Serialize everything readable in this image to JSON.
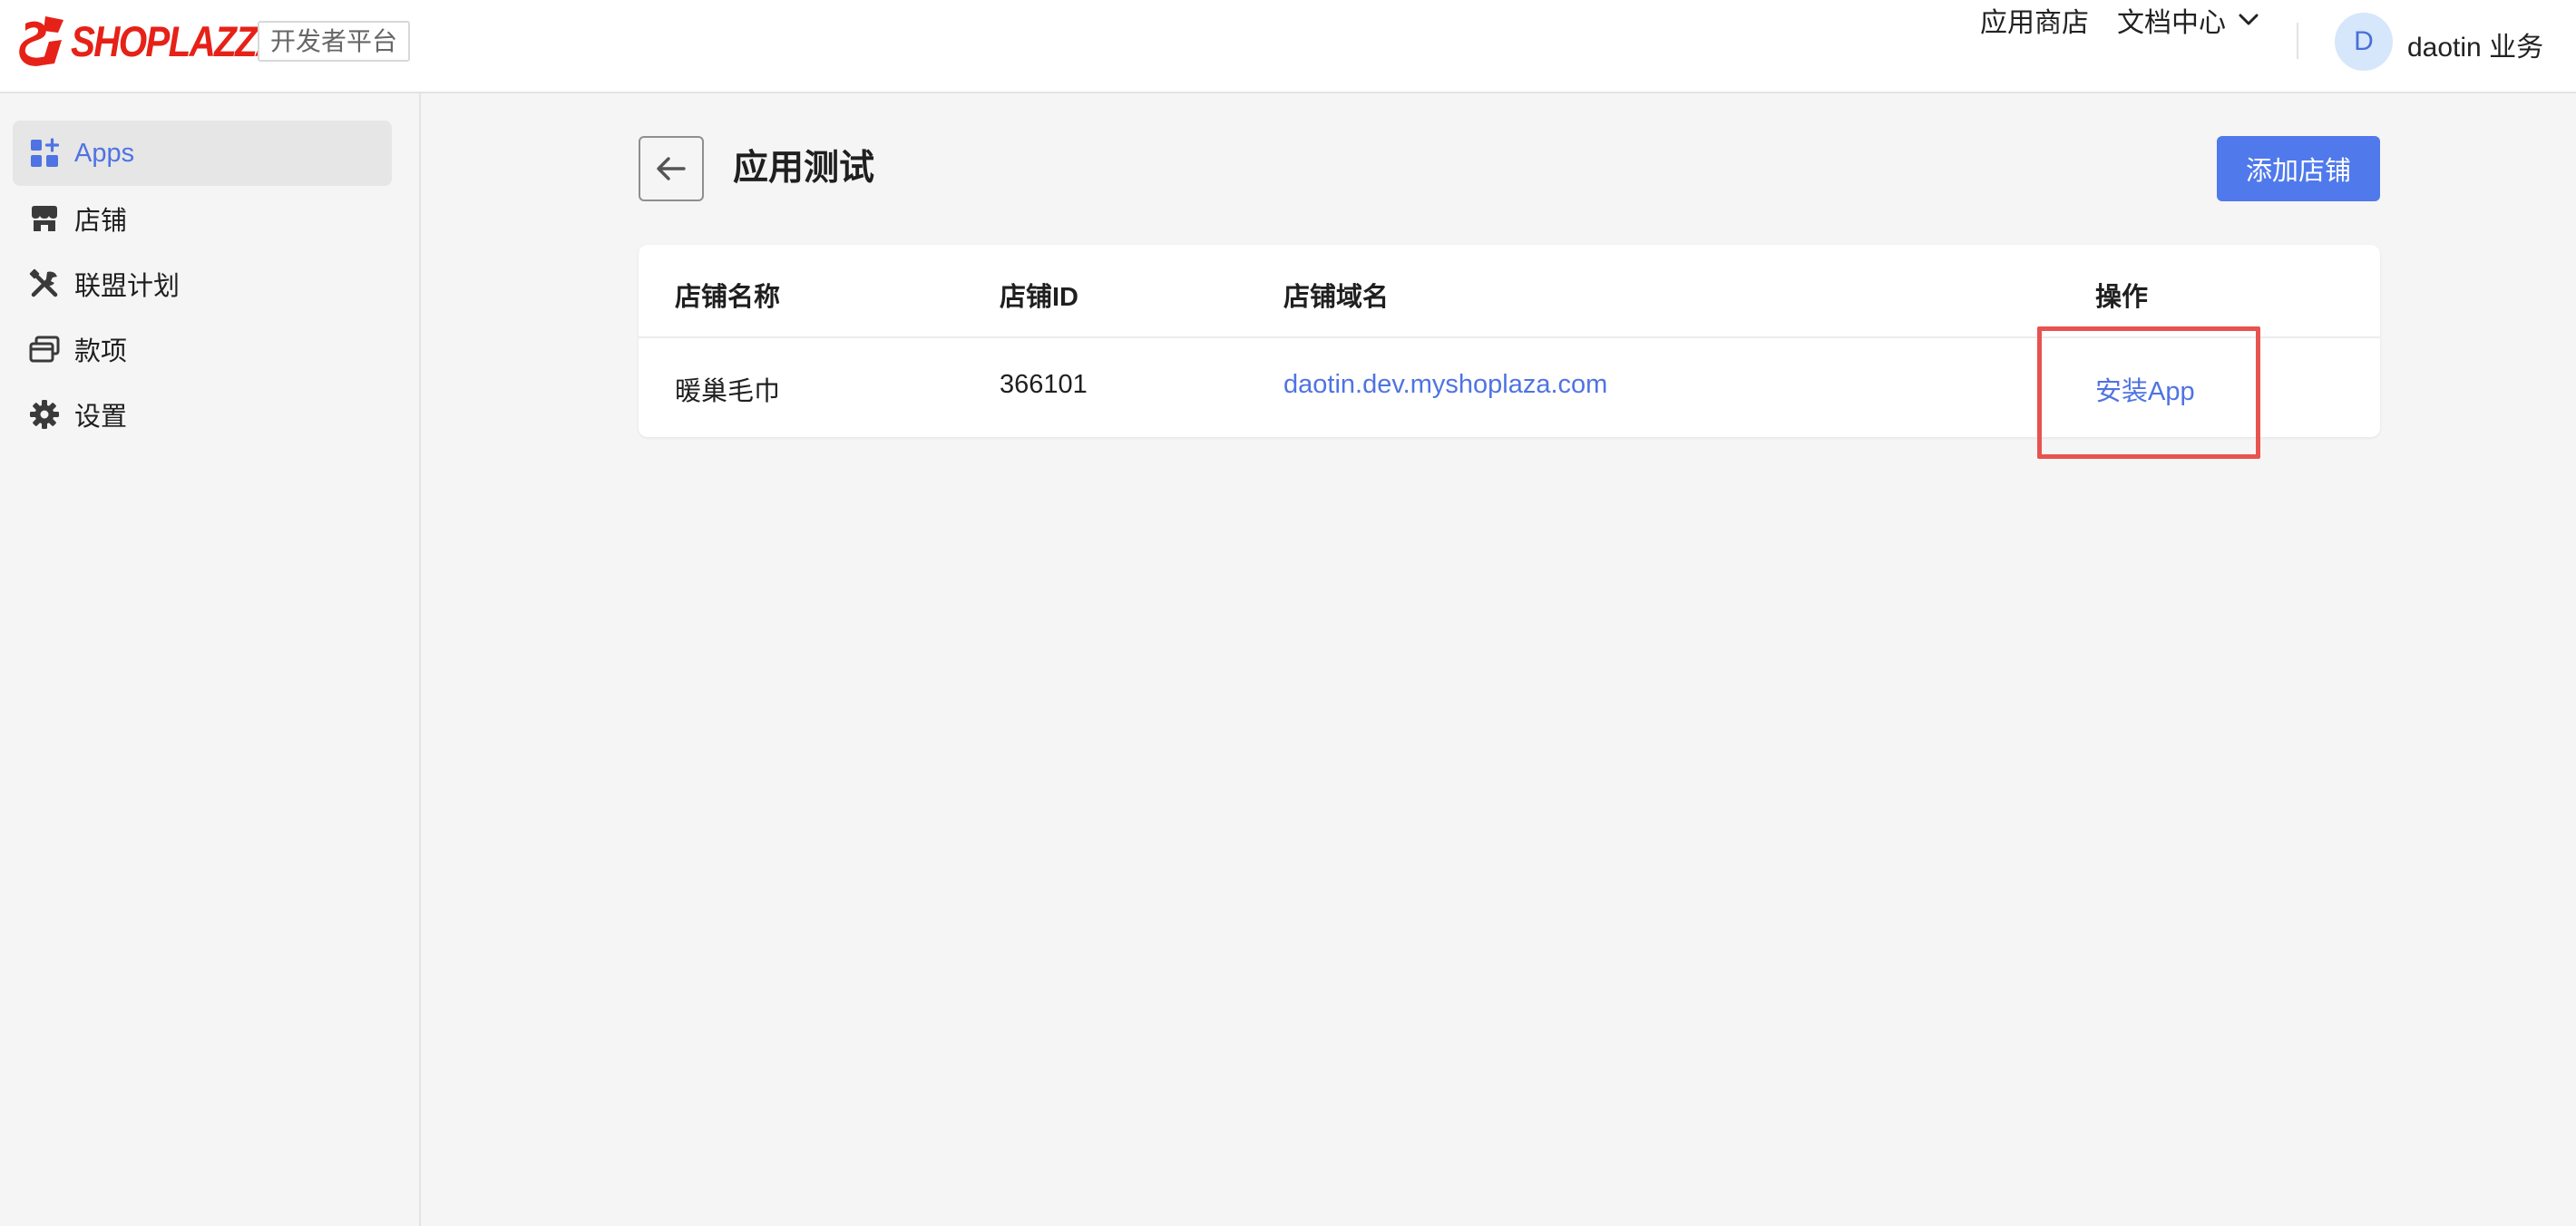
{
  "header": {
    "brand": "SHOPLAZZA",
    "platform_badge": "开发者平台",
    "nav": {
      "app_store": "应用商店",
      "docs_center": "文档中心"
    },
    "user": {
      "avatar_initial": "D",
      "name": "daotin 业务"
    }
  },
  "sidebar": {
    "items": [
      {
        "label": "Apps",
        "icon": "apps-grid-icon",
        "active": true
      },
      {
        "label": "店铺",
        "icon": "store-icon",
        "active": false
      },
      {
        "label": "联盟计划",
        "icon": "tools-icon",
        "active": false
      },
      {
        "label": "款项",
        "icon": "payment-card-icon",
        "active": false
      },
      {
        "label": "设置",
        "icon": "gear-icon",
        "active": false
      }
    ]
  },
  "main": {
    "title": "应用测试",
    "add_store_button": "添加店铺",
    "table": {
      "columns": [
        "店铺名称",
        "店铺ID",
        "店铺域名",
        "操作"
      ],
      "rows": [
        {
          "name": "暖巢毛巾",
          "id": "366101",
          "domain": "daotin.dev.myshoplaza.com",
          "action": "安装App"
        }
      ]
    }
  },
  "colors": {
    "brand_red": "#e62117",
    "primary_blue": "#5079ec",
    "link_blue": "#4f73e3",
    "highlight_red": "#e8534f"
  }
}
